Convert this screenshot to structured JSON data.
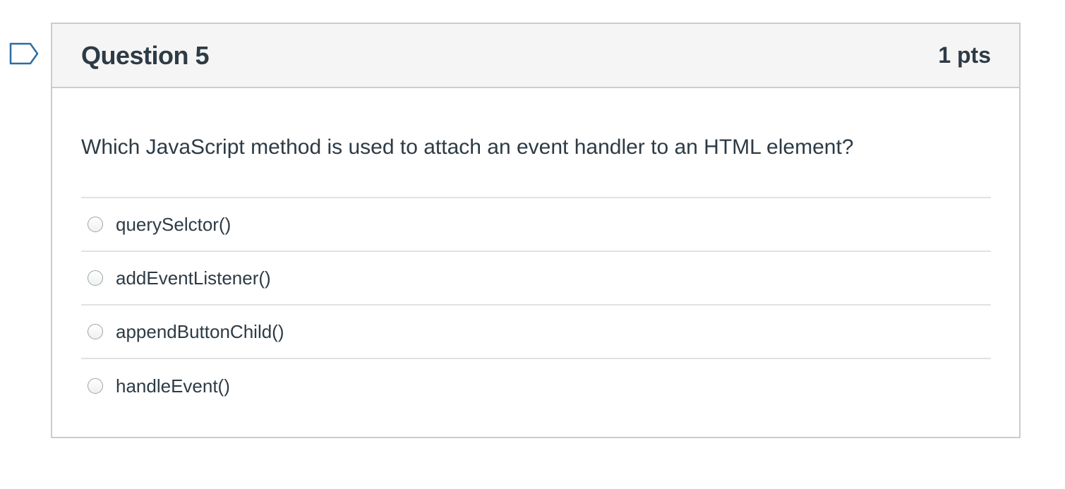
{
  "question": {
    "title": "Question 5",
    "points": "1 pts",
    "text": "Which JavaScript method is used to attach an event handler to an HTML element?",
    "answers": [
      {
        "label": "querySelctor()"
      },
      {
        "label": "addEventListener()"
      },
      {
        "label": "appendButtonChild()"
      },
      {
        "label": "handleEvent()"
      }
    ]
  },
  "colors": {
    "text": "#2d3b45",
    "border": "#c7cdd1",
    "header_bg": "#f5f5f5",
    "flag": "#2d6ca2"
  },
  "icons": {
    "flag": "flag-question-icon",
    "radio": "radio-unchecked"
  }
}
